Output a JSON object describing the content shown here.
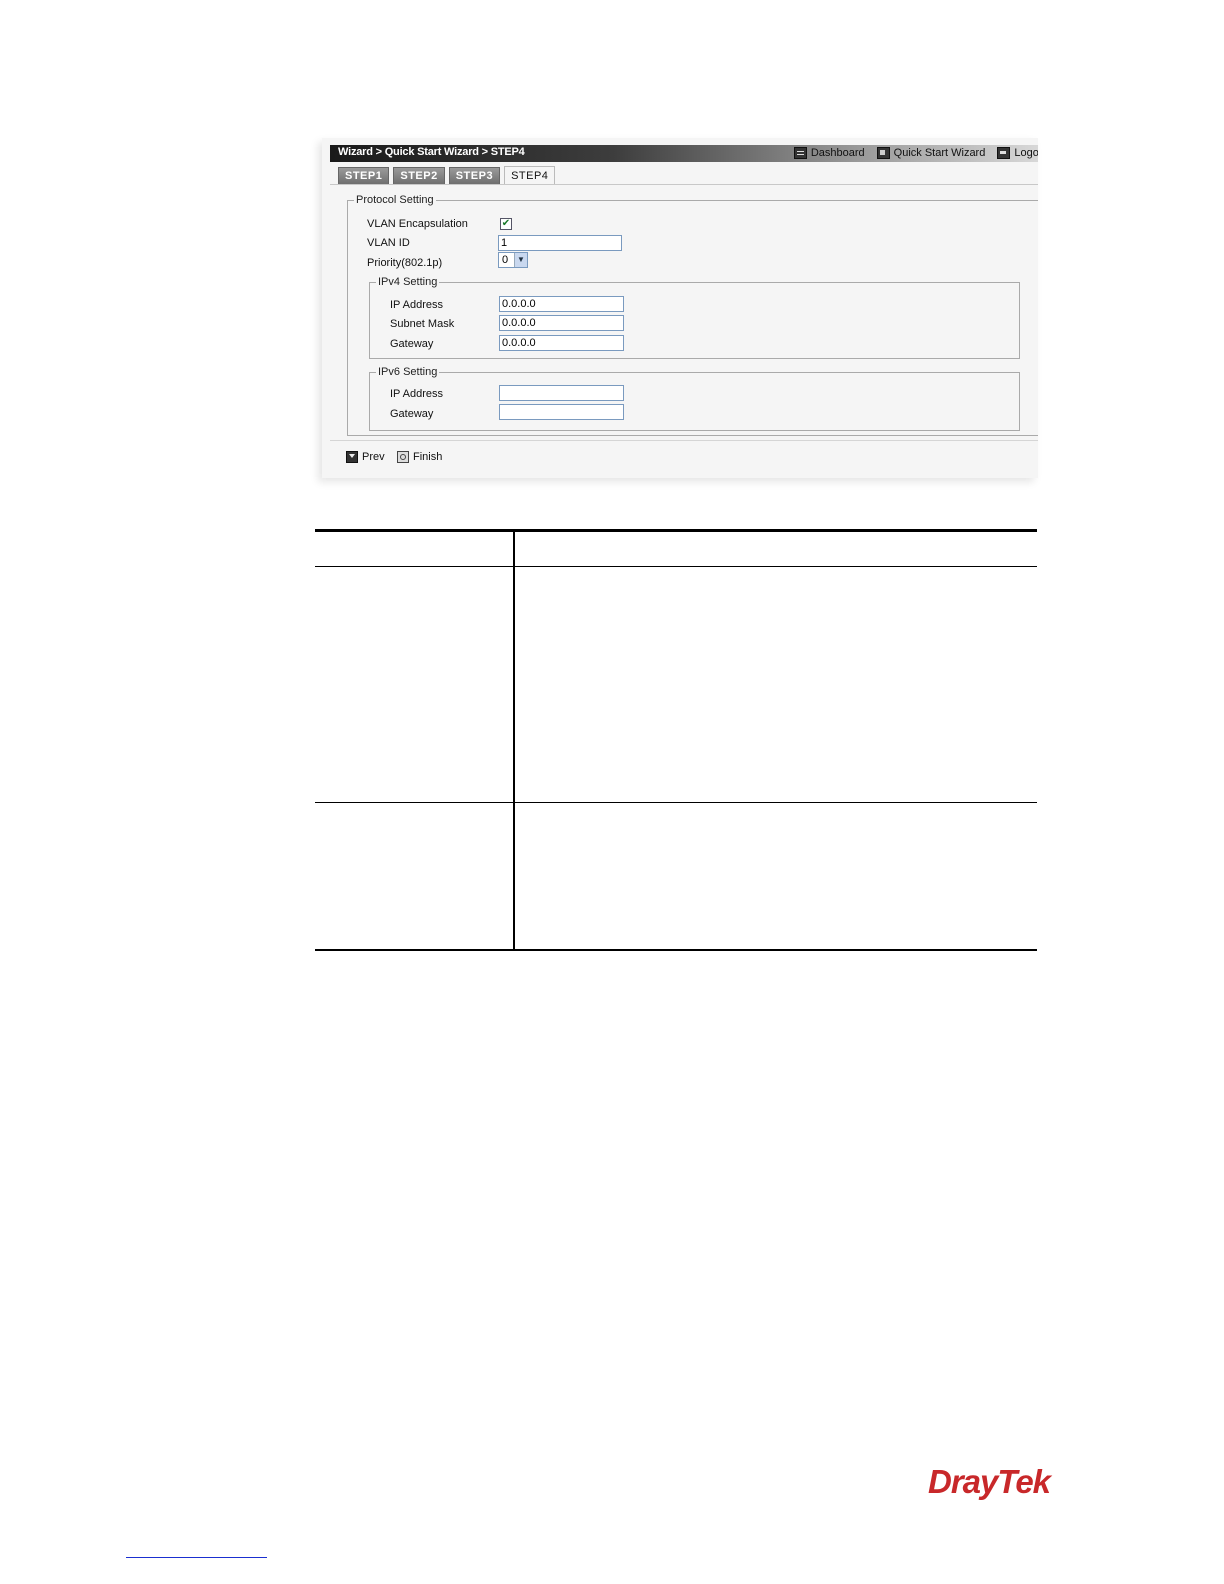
{
  "header": {
    "breadcrumb": "Wizard > Quick Start Wizard > STEP4",
    "links": [
      {
        "label": "Dashboard",
        "icon": "dashboard-icon"
      },
      {
        "label": "Quick Start Wizard",
        "icon": "wizard-icon"
      },
      {
        "label": "Logout",
        "icon": "logout-icon"
      }
    ]
  },
  "tabs": [
    {
      "label": "STEP1",
      "active": false
    },
    {
      "label": "STEP2",
      "active": false
    },
    {
      "label": "STEP3",
      "active": false
    },
    {
      "label": "STEP4",
      "active": true
    }
  ],
  "protocol": {
    "legend": "Protocol Setting",
    "vlan_encap_label": "VLAN Encapsulation",
    "vlan_encap_checked": true,
    "vlan_id_label": "VLAN ID",
    "vlan_id_value": "1",
    "priority_label": "Priority(802.1p)",
    "priority_value": "0"
  },
  "ipv4": {
    "legend": "IPv4 Setting",
    "ip_label": "IP Address",
    "ip_value": "0.0.0.0",
    "mask_label": "Subnet Mask",
    "mask_value": "0.0.0.0",
    "gateway_label": "Gateway",
    "gateway_value": "0.0.0.0"
  },
  "ipv6": {
    "legend": "IPv6 Setting",
    "ip_label": "IP Address",
    "ip_value": "",
    "gateway_label": "Gateway",
    "gateway_value": ""
  },
  "footer": {
    "prev_label": "Prev",
    "finish_label": "Finish"
  },
  "brand": {
    "logo_text": "DrayTek",
    "logo_color": "#c8282a"
  },
  "colors": {
    "input_border": "#7a9abf",
    "check_color": "#1a7a2a"
  }
}
